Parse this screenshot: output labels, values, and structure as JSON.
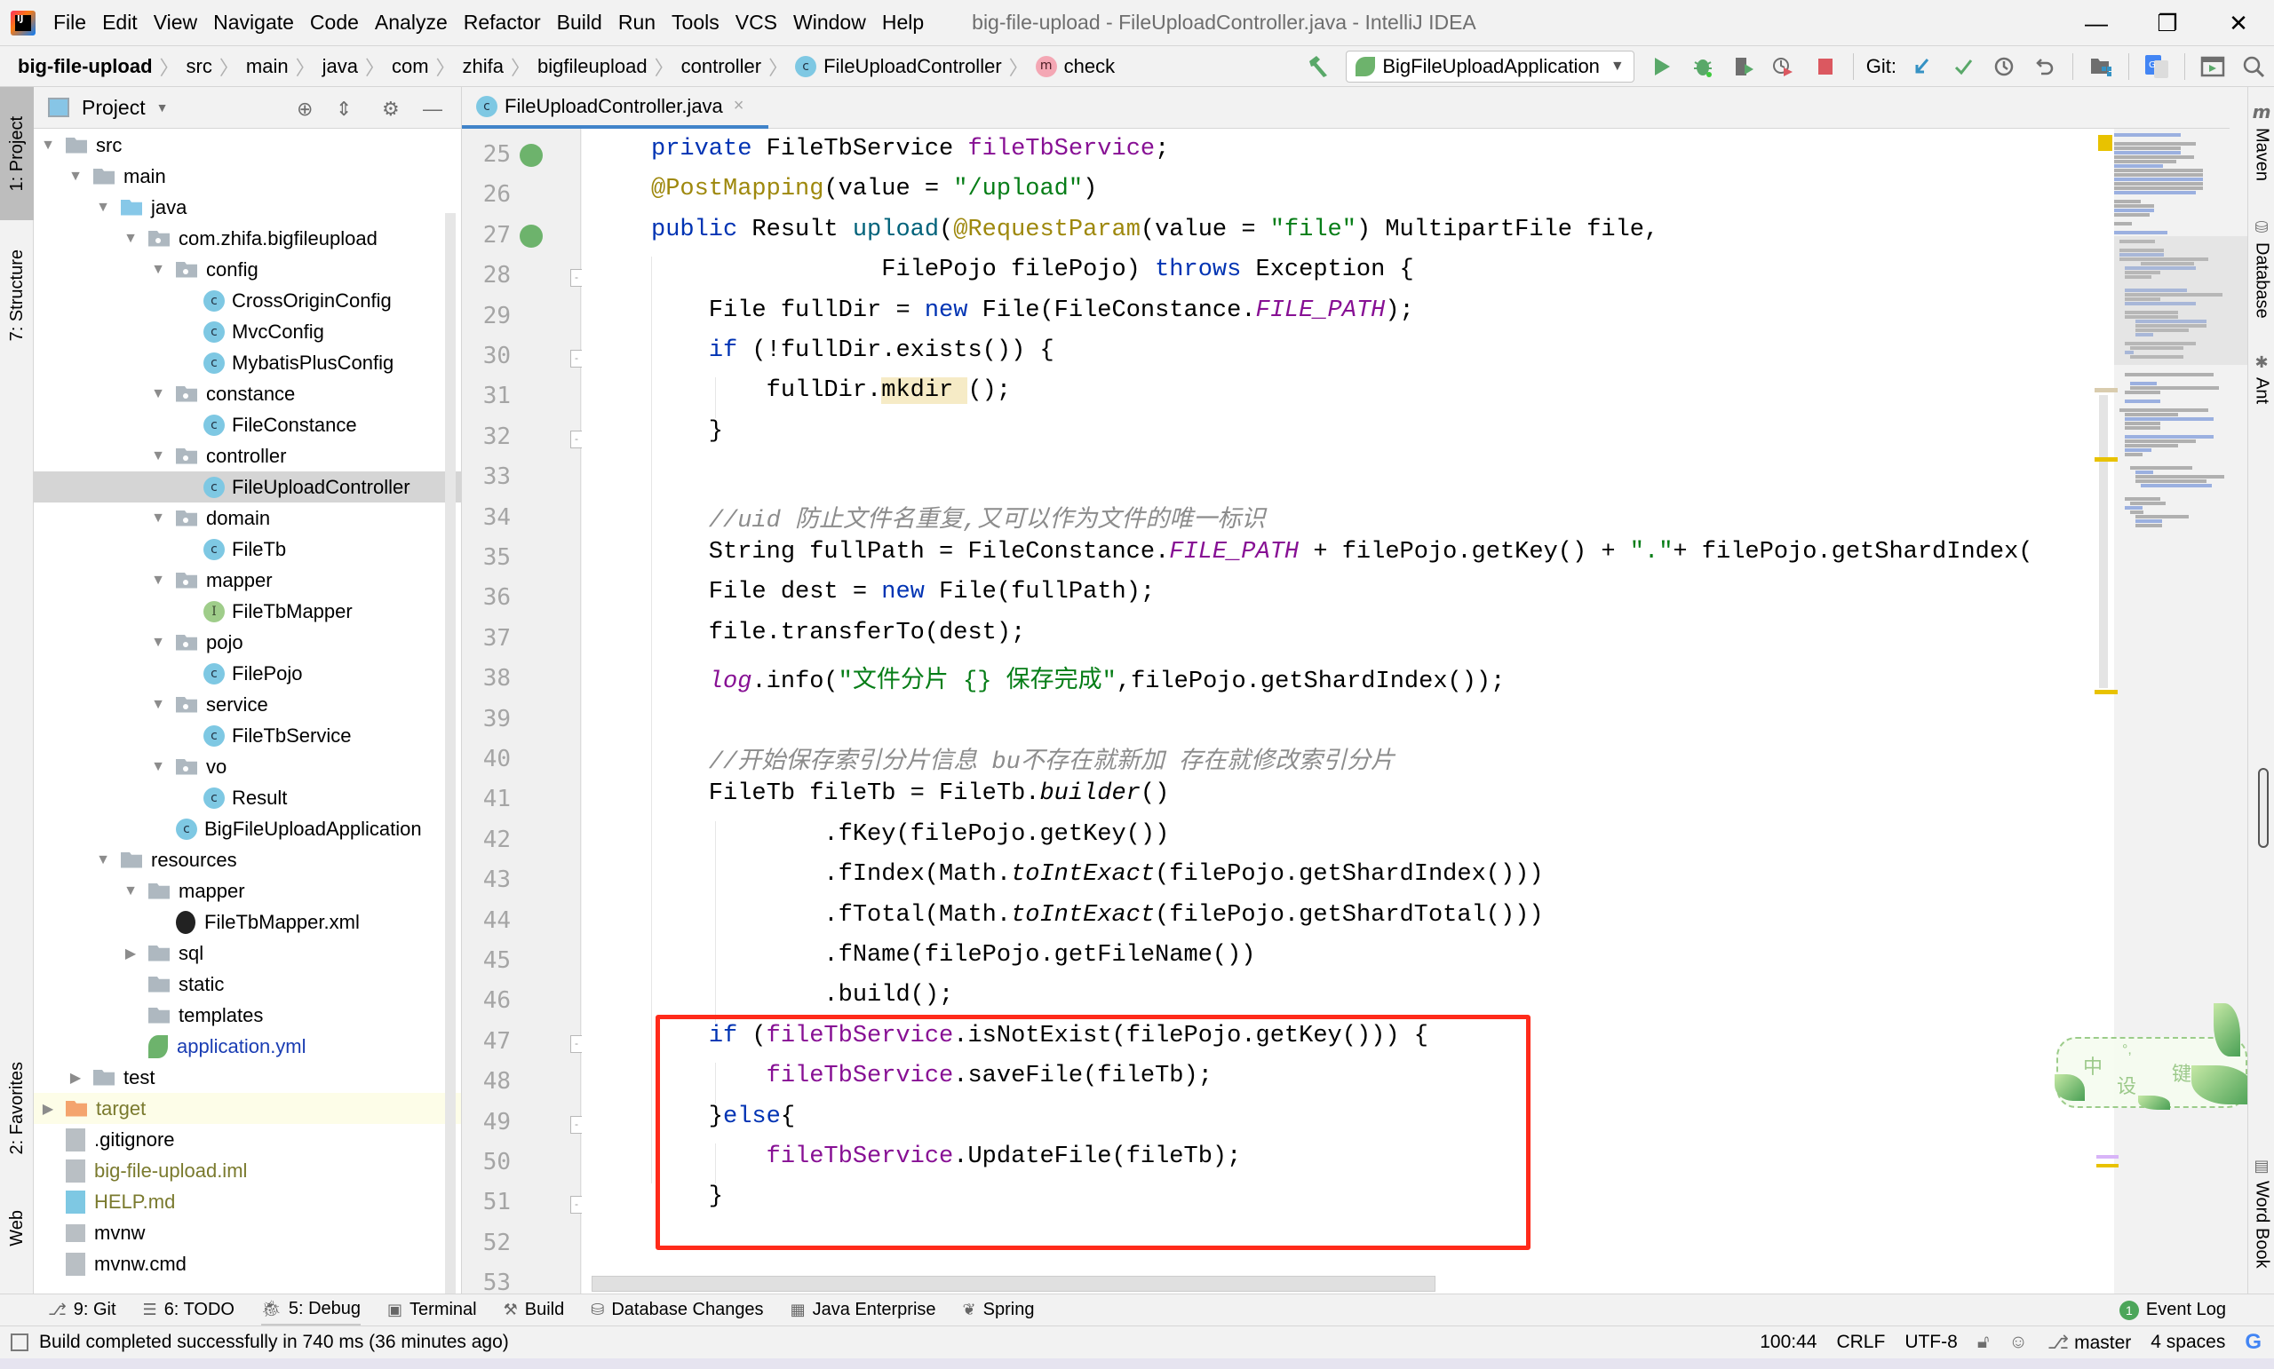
{
  "menubar": {
    "logo": "IJ",
    "items": [
      "File",
      "Edit",
      "View",
      "Navigate",
      "Code",
      "Analyze",
      "Refactor",
      "Build",
      "Run",
      "Tools",
      "VCS",
      "Window",
      "Help"
    ],
    "window_title": "big-file-upload - FileUploadController.java - IntelliJ IDEA",
    "window_controls": {
      "minimize": "—",
      "restore": "❐",
      "close": "✕"
    }
  },
  "breadcrumb": {
    "items": [
      "big-file-upload",
      "src",
      "main",
      "java",
      "com",
      "zhifa",
      "bigfileupload",
      "controller",
      "FileUploadController",
      "check"
    ],
    "class_icon": "c",
    "method_icon": "m"
  },
  "toolbar": {
    "run_config": "BigFileUploadApplication",
    "git_label": "Git:",
    "icons": [
      "build-hammer-icon",
      "run-icon",
      "debug-icon",
      "coverage-icon",
      "profile-icon",
      "stop-icon",
      "git-update-icon",
      "git-commit-icon",
      "git-history-icon",
      "git-rollback-icon",
      "project-structure-icon",
      "translate-icon",
      "presentation-icon",
      "search-icon"
    ]
  },
  "left_strip": {
    "tabs": [
      {
        "label": "1: Project",
        "active": true
      },
      {
        "label": "7: Structure",
        "active": false
      },
      {
        "label": "2: Favorites",
        "active": false
      },
      {
        "label": "Web",
        "active": false
      }
    ]
  },
  "project": {
    "title": "Project",
    "tree": [
      {
        "label": "src",
        "level": 0,
        "type": "folder",
        "arrow": "down"
      },
      {
        "label": "main",
        "level": 1,
        "type": "folder",
        "arrow": "down"
      },
      {
        "label": "java",
        "level": 2,
        "type": "folder-blue",
        "arrow": "down"
      },
      {
        "label": "com.zhifa.bigfileupload",
        "level": 3,
        "type": "package",
        "arrow": "down"
      },
      {
        "label": "config",
        "level": 4,
        "type": "package",
        "arrow": "down"
      },
      {
        "label": "CrossOriginConfig",
        "level": 5,
        "type": "class"
      },
      {
        "label": "MvcConfig",
        "level": 5,
        "type": "class"
      },
      {
        "label": "MybatisPlusConfig",
        "level": 5,
        "type": "class"
      },
      {
        "label": "constance",
        "level": 4,
        "type": "package",
        "arrow": "down"
      },
      {
        "label": "FileConstance",
        "level": 5,
        "type": "class"
      },
      {
        "label": "controller",
        "level": 4,
        "type": "package",
        "arrow": "down"
      },
      {
        "label": "FileUploadController",
        "level": 5,
        "type": "class",
        "selected": true
      },
      {
        "label": "domain",
        "level": 4,
        "type": "package",
        "arrow": "down"
      },
      {
        "label": "FileTb",
        "level": 5,
        "type": "class"
      },
      {
        "label": "mapper",
        "level": 4,
        "type": "package",
        "arrow": "down"
      },
      {
        "label": "FileTbMapper",
        "level": 5,
        "type": "interface"
      },
      {
        "label": "pojo",
        "level": 4,
        "type": "package",
        "arrow": "down"
      },
      {
        "label": "FilePojo",
        "level": 5,
        "type": "class"
      },
      {
        "label": "service",
        "level": 4,
        "type": "package",
        "arrow": "down"
      },
      {
        "label": "FileTbService",
        "level": 5,
        "type": "class"
      },
      {
        "label": "vo",
        "level": 4,
        "type": "package",
        "arrow": "down"
      },
      {
        "label": "Result",
        "level": 5,
        "type": "class"
      },
      {
        "label": "BigFileUploadApplication",
        "level": 4,
        "type": "spring-class"
      },
      {
        "label": "resources",
        "level": 2,
        "type": "folder-res",
        "arrow": "down"
      },
      {
        "label": "mapper",
        "level": 3,
        "type": "folder",
        "arrow": "down"
      },
      {
        "label": "FileTbMapper.xml",
        "level": 4,
        "type": "mybatis-xml"
      },
      {
        "label": "sql",
        "level": 3,
        "type": "folder",
        "arrow": "right"
      },
      {
        "label": "static",
        "level": 3,
        "type": "folder"
      },
      {
        "label": "templates",
        "level": 3,
        "type": "folder"
      },
      {
        "label": "application.yml",
        "level": 3,
        "type": "yml",
        "color": "blue"
      },
      {
        "label": "test",
        "level": 1,
        "type": "folder",
        "arrow": "right"
      },
      {
        "label": "target",
        "level": 0,
        "type": "folder-orange",
        "arrow": "right",
        "color": "olive",
        "excluded": true
      },
      {
        "label": ".gitignore",
        "level": 0,
        "type": "file"
      },
      {
        "label": "big-file-upload.iml",
        "level": 0,
        "type": "file",
        "color": "olive"
      },
      {
        "label": "HELP.md",
        "level": 0,
        "type": "md",
        "color": "olive"
      },
      {
        "label": "mvnw",
        "level": 0,
        "type": "shell"
      },
      {
        "label": "mvnw.cmd",
        "level": 0,
        "type": "file"
      }
    ]
  },
  "editor": {
    "tab": {
      "label": "FileUploadController.java",
      "close": "×"
    },
    "lines": [
      {
        "n": "25",
        "mark": "bean"
      },
      {
        "n": "26"
      },
      {
        "n": "27",
        "mark": "endpoint"
      },
      {
        "n": "28",
        "fold": true
      },
      {
        "n": "29"
      },
      {
        "n": "30",
        "fold": true
      },
      {
        "n": "31"
      },
      {
        "n": "32",
        "fold": true
      },
      {
        "n": "33"
      },
      {
        "n": "34"
      },
      {
        "n": "35"
      },
      {
        "n": "36"
      },
      {
        "n": "37"
      },
      {
        "n": "38"
      },
      {
        "n": "39"
      },
      {
        "n": "40"
      },
      {
        "n": "41"
      },
      {
        "n": "42"
      },
      {
        "n": "43"
      },
      {
        "n": "44"
      },
      {
        "n": "45"
      },
      {
        "n": "46"
      },
      {
        "n": "47",
        "fold": true
      },
      {
        "n": "48"
      },
      {
        "n": "49",
        "fold": true
      },
      {
        "n": "50"
      },
      {
        "n": "51",
        "fold": true
      },
      {
        "n": "52"
      },
      {
        "n": "53"
      }
    ],
    "code": [
      [
        [
          "kw",
          "private"
        ],
        [
          "",
          "FileTbService "
        ],
        [
          "fld",
          "fileTbService"
        ],
        [
          "",
          ";"
        ]
      ],
      [
        [
          "ann",
          "@PostMapping"
        ],
        [
          "",
          "(value = "
        ],
        [
          "str",
          "\"/upload\""
        ],
        [
          "",
          ")"
        ]
      ],
      [
        [
          "kw",
          "public"
        ],
        [
          "",
          "Result "
        ],
        [
          "mtd",
          "upload"
        ],
        [
          "",
          "("
        ],
        [
          "ann",
          "@RequestParam"
        ],
        [
          "",
          "(value = "
        ],
        [
          "str",
          "\"file\""
        ],
        [
          "",
          ") MultipartFile file,"
        ]
      ],
      [
        [
          "",
          "                FilePojo filePojo) "
        ],
        [
          "kw",
          "throws"
        ],
        [
          "",
          "Exception {"
        ]
      ],
      [
        [
          "",
          "    File fullDir = "
        ],
        [
          "kw",
          "new"
        ],
        [
          "",
          "File(FileConstance."
        ],
        [
          "fldi",
          "FILE_PATH"
        ],
        [
          "",
          ");"
        ]
      ],
      [
        [
          "",
          "    "
        ],
        [
          "kw",
          "if"
        ],
        [
          "",
          "(!fullDir.exists()) {"
        ]
      ],
      [
        [
          "",
          "        fullDir."
        ],
        [
          "hl",
          "mkdir"
        ],
        [
          "",
          "();"
        ]
      ],
      [
        [
          "",
          "    }"
        ]
      ],
      [],
      [
        [
          "",
          "    "
        ],
        [
          "cmt",
          "//uid 防止文件名重复,又可以作为文件的唯一标识"
        ]
      ],
      [
        [
          "",
          "    String fullPath = FileConstance."
        ],
        [
          "fldi",
          "FILE_PATH"
        ],
        [
          "",
          ""
        ],
        [
          "",
          "+ filePojo.getKey() + "
        ],
        [
          "str",
          "\".\""
        ],
        [
          "",
          ""
        ],
        [
          "",
          "+ filePojo.getShardIndex("
        ]
      ],
      [
        [
          "",
          "    File dest = "
        ],
        [
          "kw",
          "new"
        ],
        [
          "",
          "File(fullPath);"
        ]
      ],
      [
        [
          "",
          "    file.transferTo(dest);"
        ]
      ],
      [
        [
          "",
          "    "
        ],
        [
          "fldi",
          "log"
        ],
        [
          "",
          ".info("
        ],
        [
          "str",
          "\"文件分片 {} 保存完成\""
        ],
        [
          "",
          ",filePojo.getShardIndex());"
        ]
      ],
      [],
      [
        [
          "",
          "    "
        ],
        [
          "cmt",
          "//开始保存索引分片信息 bu不存在就新加 存在就修改索引分片"
        ]
      ],
      [
        [
          "",
          "    FileTb fileTb = FileTb."
        ],
        [
          "ital",
          "builder"
        ],
        [
          "",
          "()"
        ]
      ],
      [
        [
          "",
          "            .fKey(filePojo.getKey())"
        ]
      ],
      [
        [
          "",
          "            .fIndex(Math."
        ],
        [
          "ital",
          "toIntExact"
        ],
        [
          "",
          "(filePojo.getShardIndex()))"
        ]
      ],
      [
        [
          "",
          "            .fTotal(Math."
        ],
        [
          "ital",
          "toIntExact"
        ],
        [
          "",
          "(filePojo.getShardTotal()))"
        ]
      ],
      [
        [
          "",
          "            .fName(filePojo.getFileName())"
        ]
      ],
      [
        [
          "",
          "            .build();"
        ]
      ],
      [
        [
          "",
          "    "
        ],
        [
          "kw",
          "if"
        ],
        [
          "",
          "("
        ],
        [
          "fld",
          "fileTbService"
        ],
        [
          "",
          ".isNotExist(filePojo.getKey())) {"
        ]
      ],
      [
        [
          "",
          "        "
        ],
        [
          "fld",
          "fileTbService"
        ],
        [
          "",
          ".saveFile(fileTb);"
        ]
      ],
      [
        [
          "",
          "    }"
        ],
        [
          "kw",
          "else"
        ],
        [
          "",
          "{"
        ]
      ],
      [
        [
          "",
          "        "
        ],
        [
          "fld",
          "fileTbService"
        ],
        [
          "",
          ".UpdateFile(fileTb);"
        ]
      ],
      [
        [
          "",
          "    }"
        ]
      ],
      [],
      []
    ]
  },
  "right_strip": {
    "tabs": [
      "Maven",
      "Database",
      "Ant",
      "Word Book"
    ]
  },
  "ime_widget": {
    "chars": [
      "中",
      "°,",
      "设",
      "键"
    ]
  },
  "bottom_tabs": {
    "items": [
      {
        "label": "9: Git",
        "icon": "git-icon"
      },
      {
        "label": "6: TODO",
        "icon": "todo-icon"
      },
      {
        "label": "5: Debug",
        "icon": "debug-icon"
      },
      {
        "label": "Terminal",
        "icon": "terminal-icon"
      },
      {
        "label": "Build",
        "icon": "build-icon"
      },
      {
        "label": "Database Changes",
        "icon": "database-changes-icon"
      },
      {
        "label": "Java Enterprise",
        "icon": "java-enterprise-icon"
      },
      {
        "label": "Spring",
        "icon": "spring-icon"
      }
    ],
    "event_log": {
      "label": "Event Log",
      "count": "1"
    }
  },
  "statusbar": {
    "message": "Build completed successfully in 740 ms (36 minutes ago)",
    "position": "100:44",
    "line_separator": "CRLF",
    "encoding": "UTF-8",
    "branch": "master",
    "indent": "4 spaces",
    "google": "G"
  },
  "colors": {
    "keyword": "#0033b3",
    "annotation": "#9e880d",
    "string": "#067d17",
    "field": "#871094",
    "comment": "#8c8c8c",
    "highlight_box": "#ff2a1a",
    "tab_underline": "#4083c9"
  }
}
